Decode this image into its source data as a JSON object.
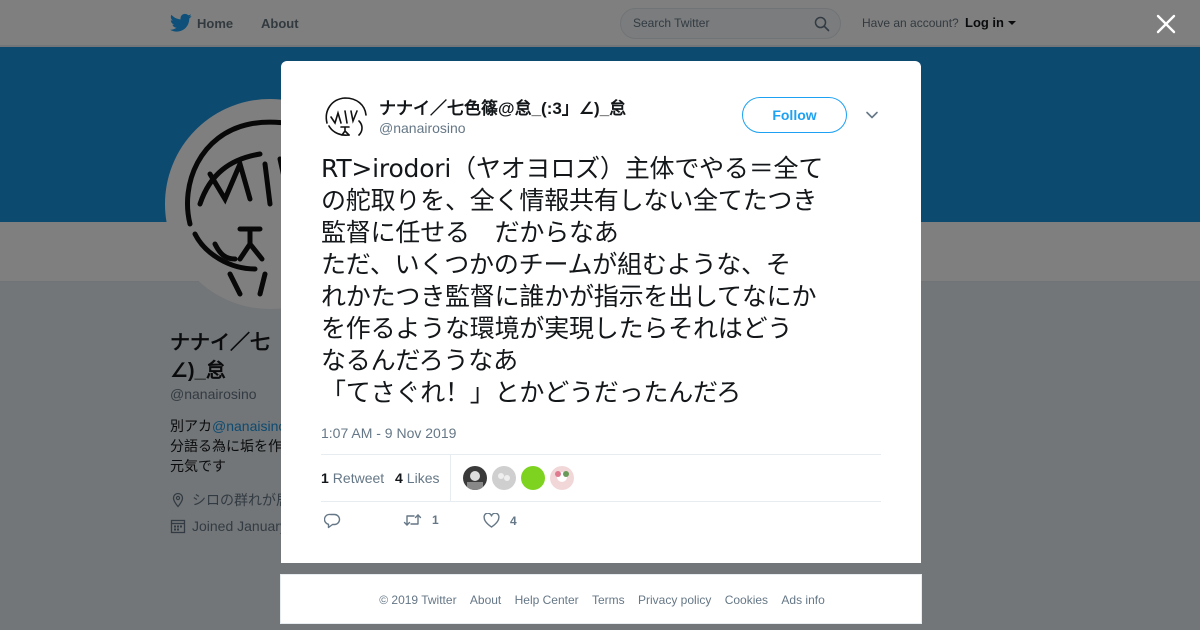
{
  "topbar": {
    "nav_home": "Home",
    "nav_about": "About",
    "search_placeholder": "Search Twitter",
    "have_account": "Have an account?",
    "login": "Log in"
  },
  "profile_bg": {
    "name_line1": "ナナイ／七",
    "name_line2": "∠)_怠",
    "handle": "@nanairosino",
    "bio_line1_prefix": "別アカ",
    "bio_line1_link": "@nanaisino",
    "bio_line2": "分語る為に垢を作",
    "bio_line3": "元気です",
    "location": "シロの群れが居",
    "joined": "Joined January"
  },
  "tweet": {
    "display_name": "ナナイ／七色篠@怠_(:3」∠)_怠",
    "handle": "@nanairosino",
    "follow_label": "Follow",
    "text_lines": [
      "RT>irodori（ヤオヨロズ）主体でやる＝全て",
      "の舵取りを、全く情報共有しない全てたつき",
      "監督に任せる　だからなあ",
      "ただ、いくつかのチームが組むような、そ",
      "れかたつき監督に誰かが指示を出してなにか",
      "を作るような環境が実現したらそれはどう",
      "なるんだろうなあ",
      "「てさぐれ！」とかどうだったんだろ"
    ],
    "timestamp": "1:07 AM - 9 Nov 2019",
    "retweet_count": "1",
    "retweet_label": "Retweet",
    "like_count": "4",
    "like_label": "Likes",
    "action_retweet_count": "1",
    "action_like_count": "4"
  },
  "footer": {
    "links": [
      "© 2019 Twitter",
      "About",
      "Help Center",
      "Terms",
      "Privacy policy",
      "Cookies",
      "Ads info"
    ]
  },
  "colors": {
    "brand_blue": "#1da1f2",
    "banner": "#1b95e0",
    "overlay": "rgba(0,0,0,0.5)"
  },
  "icons": [
    "twitter-bird-icon",
    "search-icon",
    "close-icon",
    "chevron-down-icon",
    "reply-icon",
    "retweet-icon",
    "heart-icon",
    "location-icon",
    "calendar-icon"
  ]
}
